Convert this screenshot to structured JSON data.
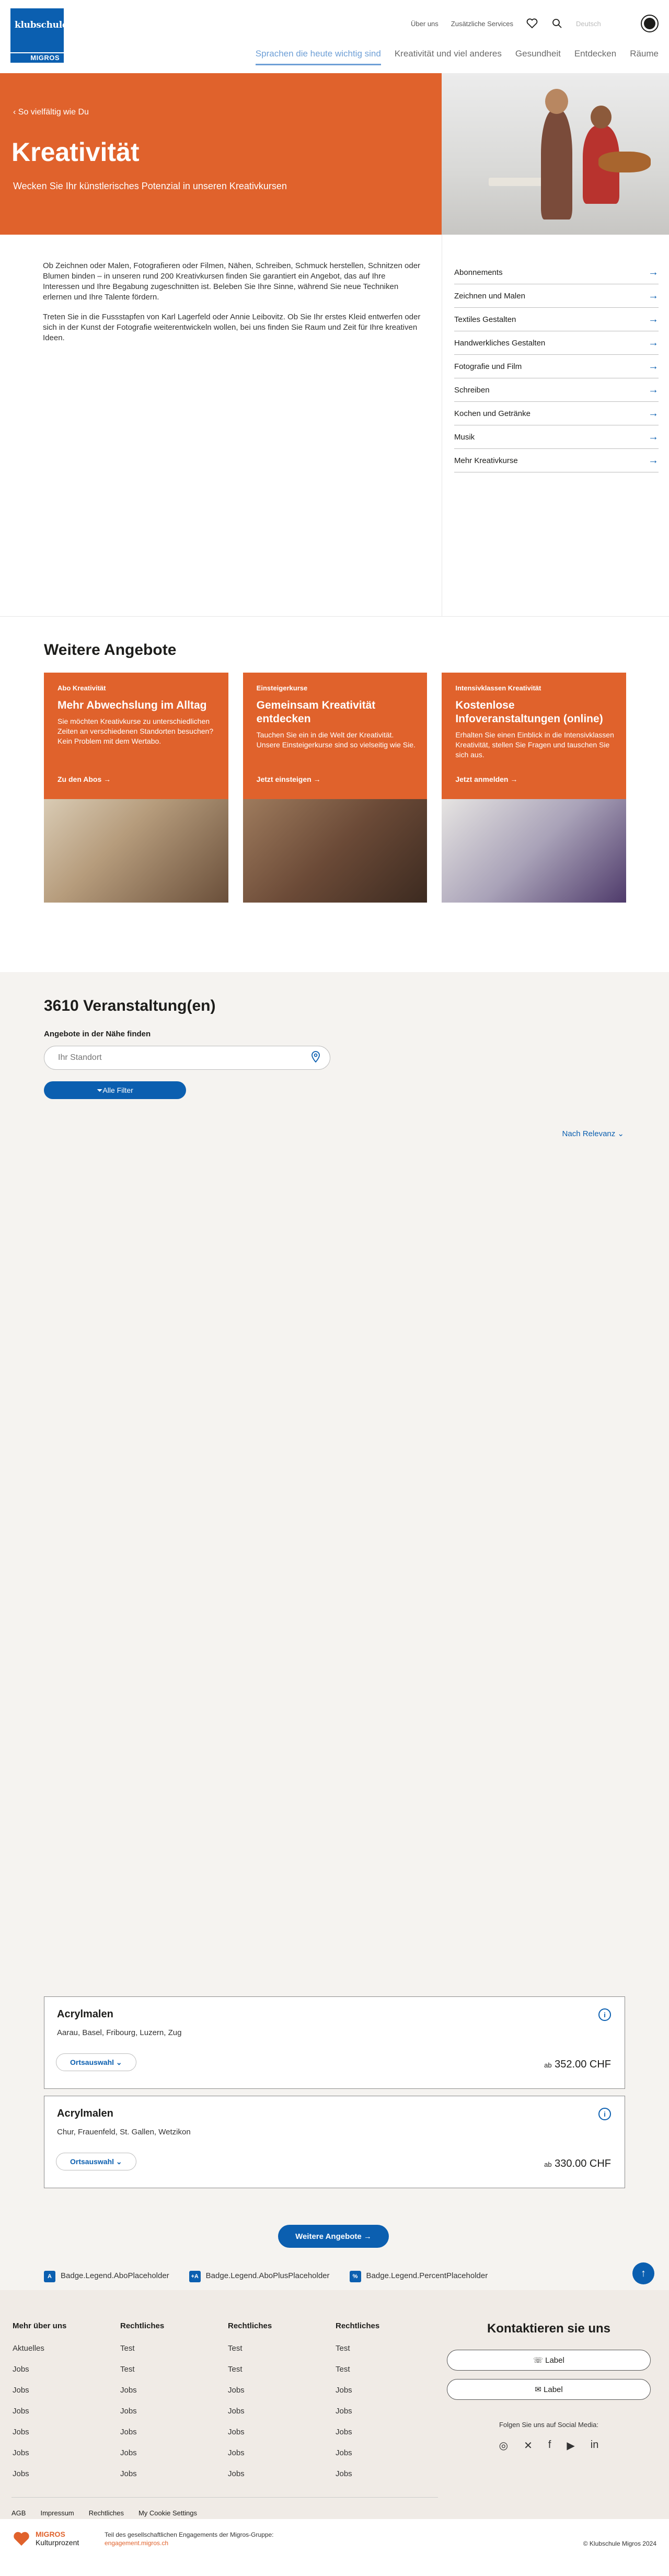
{
  "header": {
    "logo_line1": "klubschule",
    "logo_line2": "MIGROS",
    "utility": {
      "about": "Über uns",
      "services": "Zusätzliche Services",
      "language": "Deutsch"
    },
    "nav": [
      "Sprachen die heute wichtig sind",
      "Kreativität und viel anderes",
      "Gesundheit",
      "Entdecken",
      "Räume"
    ]
  },
  "hero": {
    "back": "So vielfältig wie Du",
    "title": "Kreativität",
    "subtitle": "Wecken Sie Ihr künstlerisches Potenzial in unseren Kreativkursen"
  },
  "intro": {
    "p1": "Ob Zeichnen oder Malen, Fotografieren oder Filmen, Nähen, Schreiben, Schmuck herstellen, Schnitzen oder Blumen binden – in unseren rund 200 Kreativkursen finden Sie garantiert ein Angebot, das auf Ihre Interessen und Ihre Begabung zugeschnitten ist. Beleben Sie Ihre Sinne, während Sie neue Techniken erlernen und Ihre Talente fördern.",
    "p2": "Treten Sie in die Fussstapfen von Karl Lagerfeld oder Annie Leibovitz. Ob Sie Ihr erstes Kleid entwerfen oder sich in der Kunst der Fotografie weiterentwickeln wollen, bei uns finden Sie Raum und Zeit für Ihre kreativen Ideen.",
    "side": [
      "Abonnements",
      "Zeichnen und Malen",
      "Textiles Gestalten",
      "Handwerkliches Gestalten",
      "Fotografie und Film",
      "Schreiben",
      "Kochen und Getränke",
      "Musik",
      "Mehr Kreativkurse"
    ]
  },
  "offers": {
    "heading": "Weitere Angebote",
    "cards": [
      {
        "tag": "Abo Kreativität",
        "title": "Mehr Abwechslung im Alltag",
        "desc": "Sie möchten Kreativkurse zu unterschiedlichen Zeiten an verschiedenen Standorten besuchen? Kein Problem mit dem Wertabo.",
        "link": "Zu den Abos →"
      },
      {
        "tag": "Einsteigerkurse",
        "title": "Gemeinsam Kreativität entdecken",
        "desc": "Tauchen Sie ein in die Welt der Kreativität. Unsere Einsteigerkurse sind so vielseitig wie Sie.",
        "link": "Jetzt einsteigen →"
      },
      {
        "tag": "Intensivklassen Kreativität",
        "title": "Kostenlose Infoveranstaltungen (online)",
        "desc": "Erhalten Sie einen Einblick in die Intensivklassen Kreativität, stellen Sie Fragen und tauschen Sie sich aus.",
        "link": "Jetzt anmelden →"
      }
    ]
  },
  "events": {
    "count": "3610 Veranstaltung(en)",
    "near": "Angebote in der Nähe finden",
    "placeholder": "Ihr Standort",
    "filter": "Alle Filter",
    "sort": "Nach Relevanz",
    "courses": [
      {
        "title": "Acrylmalen",
        "locations": "Aarau, Basel, Fribourg, Luzern, Zug",
        "ort": "Ortsauswahl",
        "price_prefix": "ab",
        "price": "352.00 CHF"
      },
      {
        "title": "Acrylmalen",
        "locations": "Chur, Frauenfeld, St. Gallen, Wetzikon",
        "ort": "Ortsauswahl",
        "price_prefix": "ab",
        "price": "330.00 CHF"
      }
    ],
    "more": "Weitere Angebote",
    "legend": [
      {
        "badge": "A",
        "label": "Badge.Legend.AboPlaceholder"
      },
      {
        "badge": "+A",
        "label": "Badge.Legend.AboPlusPlaceholder"
      },
      {
        "badge": "%",
        "label": "Badge.Legend.PercentPlaceholder"
      }
    ]
  },
  "footer": {
    "columns": [
      {
        "heading": "Mehr über uns",
        "links": [
          "Aktuelles",
          "Jobs",
          "Jobs",
          "Jobs",
          "Jobs",
          "Jobs",
          "Jobs"
        ]
      },
      {
        "heading": "Rechtliches",
        "links": [
          "Test",
          "Test",
          "Jobs",
          "Jobs",
          "Jobs",
          "Jobs",
          "Jobs"
        ]
      },
      {
        "heading": "Rechtliches",
        "links": [
          "Test",
          "Test",
          "Jobs",
          "Jobs",
          "Jobs",
          "Jobs",
          "Jobs"
        ]
      },
      {
        "heading": "Rechtliches",
        "links": [
          "Test",
          "Test",
          "Jobs",
          "Jobs",
          "Jobs",
          "Jobs",
          "Jobs"
        ]
      }
    ],
    "contact": {
      "heading": "Kontaktieren sie uns",
      "phone": "Label",
      "mail": "Label",
      "social": "Folgen Sie uns auf Social Media:"
    },
    "bottom": [
      "AGB",
      "Impressum",
      "Rechtliches",
      "My Cookie Settings"
    ],
    "kp": {
      "brand": "MIGROS",
      "sub": "Kulturprozent",
      "text1": "Teil des gesellschaftlichen Engagements der Migros-Gruppe:",
      "text2": "engagement.migros.ch"
    },
    "copyright": "© Klubschule Migros 2024"
  },
  "colors": {
    "accent_orange": "#e0622c",
    "brand_blue": "#0b5fb0",
    "footer_bg": "#f0ebe6",
    "events_bg": "#f5f3f0"
  }
}
